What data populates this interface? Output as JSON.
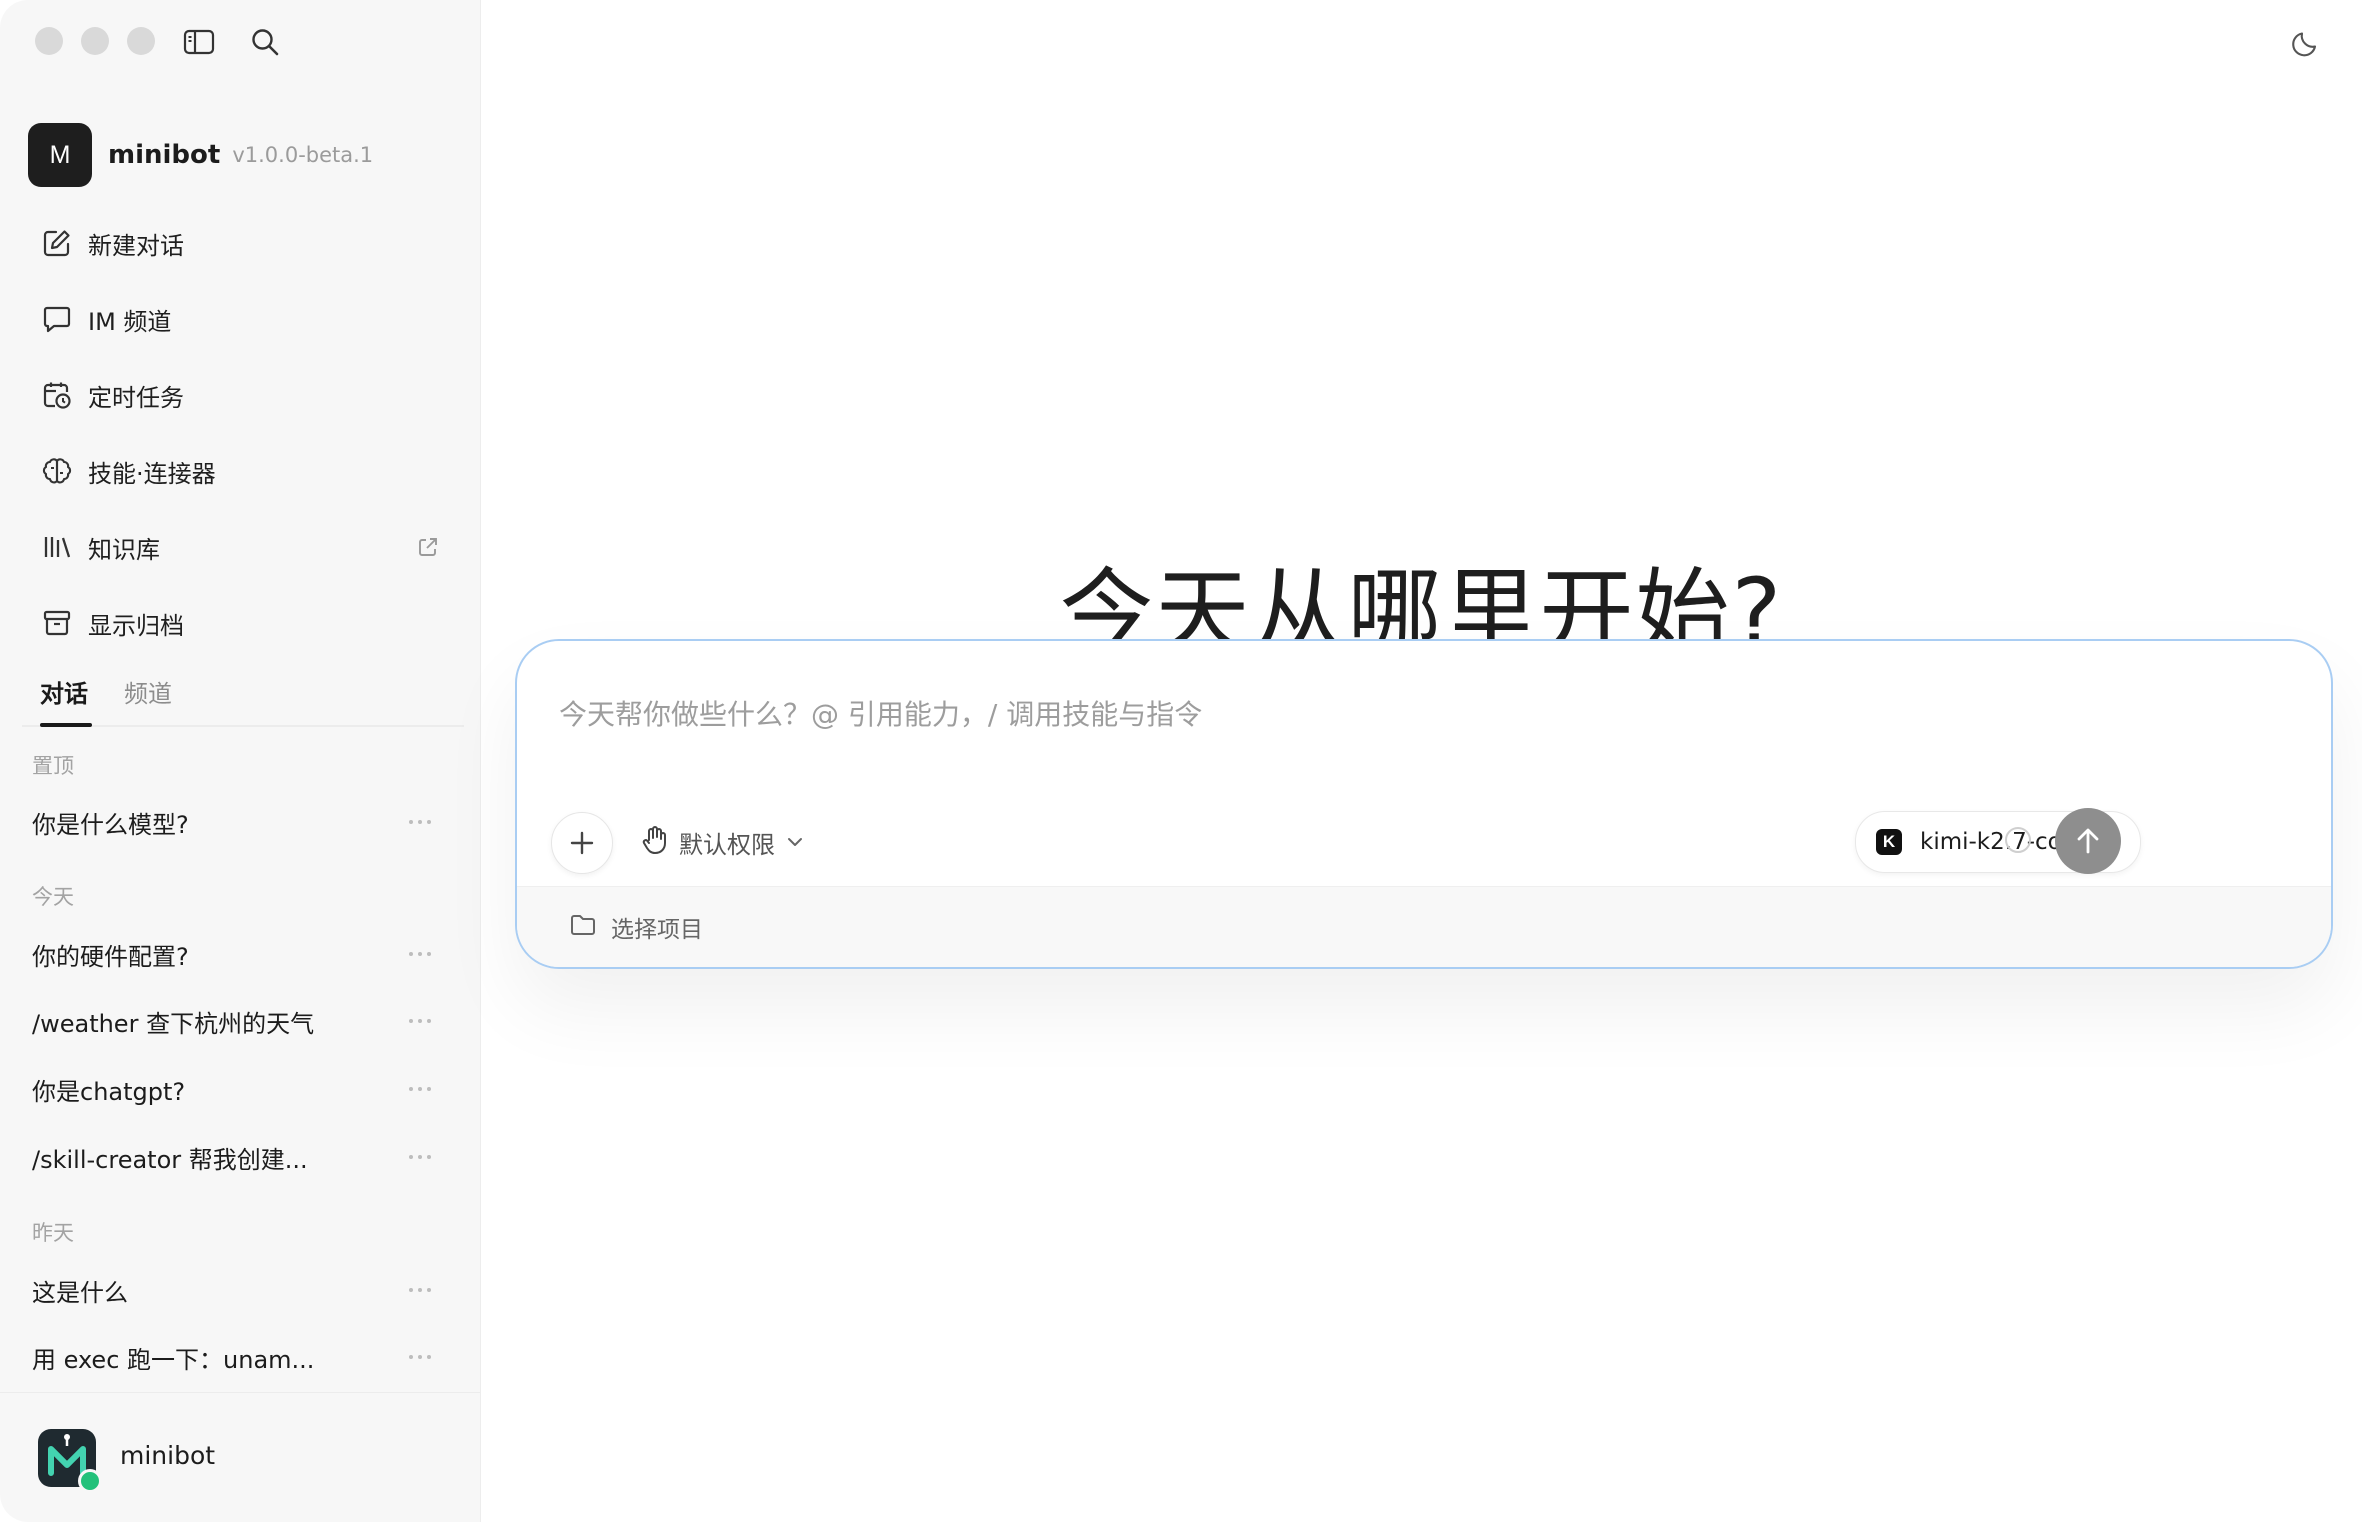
{
  "app": {
    "name": "minibot",
    "version": "v1.0.0-beta.1",
    "avatar_letter": "M"
  },
  "nav": {
    "items": [
      {
        "label": "新建对话",
        "icon": "edit-icon"
      },
      {
        "label": "IM 频道",
        "icon": "chat-bubble-icon"
      },
      {
        "label": "定时任务",
        "icon": "calendar-clock-icon"
      },
      {
        "label": "技能·连接器",
        "icon": "brain-icon"
      },
      {
        "label": "知识库",
        "icon": "library-icon",
        "external": "external-link-icon"
      },
      {
        "label": "显示归档",
        "icon": "archive-icon"
      }
    ]
  },
  "tabs": [
    {
      "label": "对话",
      "active": true
    },
    {
      "label": "频道",
      "active": false
    }
  ],
  "groups": {
    "pinned": {
      "label": "置顶",
      "items": [
        "你是什么模型?"
      ]
    },
    "today": {
      "label": "今天",
      "items": [
        "你的硬件配置?",
        "/weather 查下杭州的天气",
        "你是chatgpt?",
        "/skill-creator 帮我创建..."
      ]
    },
    "yesterday": {
      "label": "昨天",
      "items": [
        "这是什么",
        "用 exec 跑一下：unam..."
      ]
    }
  },
  "more_icon": "more-horizontal-icon",
  "user": {
    "name": "minibot",
    "status_color": "#22c17a"
  },
  "main": {
    "heading": "今天从哪里开始?",
    "theme_icon": "moon-icon"
  },
  "composer": {
    "placeholder": "今天帮你做些什么？@ 引用能力，/ 调用技能与指令",
    "value": "",
    "permission_label": "默认权限",
    "model_logo_letter": "K",
    "model_name": "kimi-k2.7-code",
    "project_label": "选择项目",
    "border_color": "#a9cdf3",
    "send_color": "#8e8e8e"
  }
}
